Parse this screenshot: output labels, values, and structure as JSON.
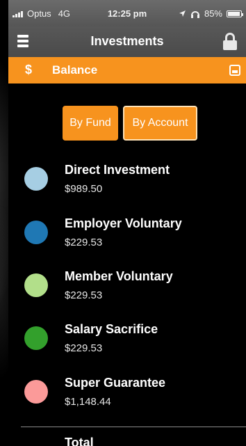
{
  "status_bar": {
    "carrier": "Optus",
    "network": "4G",
    "time": "12:25 pm",
    "battery": "85%",
    "icons": [
      "signal-icon",
      "location-arrow-icon",
      "headphones-icon",
      "battery-icon"
    ]
  },
  "header": {
    "title": "Investments",
    "menu_icon": "hamburger-menu-icon",
    "lock_icon": "lock-icon"
  },
  "balance_bar": {
    "icon": "dollar-icon",
    "label": "Balance",
    "toggle_icon": "collapse-icon",
    "color": "#f7931e"
  },
  "toggles": {
    "by_fund": "By Fund",
    "by_account": "By Account"
  },
  "funds": [
    {
      "name": "Direct Investment",
      "amount": "$989.50",
      "color": "#a6cee3"
    },
    {
      "name": "Employer Voluntary",
      "amount": "$229.53",
      "color": "#1f78b4"
    },
    {
      "name": "Member Voluntary",
      "amount": "$229.53",
      "color": "#b2df8a"
    },
    {
      "name": "Salary Sacrifice",
      "amount": "$229.53",
      "color": "#33a02c"
    },
    {
      "name": "Super Guarantee",
      "amount": "$1,148.44",
      "color": "#fb9a99"
    }
  ],
  "total": {
    "label": "Total"
  }
}
